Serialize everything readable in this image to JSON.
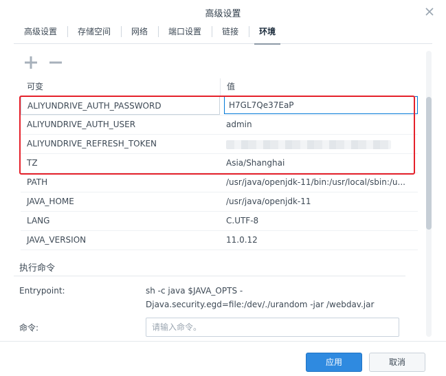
{
  "dialog": {
    "title": "高级设置",
    "close_icon": "close-icon"
  },
  "tabs": [
    {
      "label": "高级设置",
      "active": false
    },
    {
      "label": "存储空间",
      "active": false
    },
    {
      "label": "网络",
      "active": false
    },
    {
      "label": "端口设置",
      "active": false
    },
    {
      "label": "链接",
      "active": false
    },
    {
      "label": "环境",
      "active": true
    }
  ],
  "toolbar": {
    "add_icon": "plus-icon",
    "remove_icon": "minus-icon"
  },
  "env_table": {
    "headers": {
      "variable": "可变",
      "value": "值"
    },
    "rows": [
      {
        "name": "ALIYUNDRIVE_AUTH_PASSWORD",
        "value": "H7GL7Qe37EaP"
      },
      {
        "name": "ALIYUNDRIVE_AUTH_USER",
        "value": "admin"
      },
      {
        "name": "ALIYUNDRIVE_REFRESH_TOKEN",
        "value": ""
      },
      {
        "name": "TZ",
        "value": "Asia/Shanghai"
      },
      {
        "name": "PATH",
        "value": "/usr/java/openjdk-11/bin:/usr/local/sbin:/u..."
      },
      {
        "name": "JAVA_HOME",
        "value": "/usr/java/openjdk-11"
      },
      {
        "name": "LANG",
        "value": "C.UTF-8"
      },
      {
        "name": "JAVA_VERSION",
        "value": "11.0.12"
      }
    ]
  },
  "exec_section": {
    "title": "执行命令",
    "entrypoint_label": "Entrypoint:",
    "entrypoint_value_line1": "sh -c java $JAVA_OPTS -",
    "entrypoint_value_line2": "Djava.security.egd=file:/dev/./urandom -jar /webdav.jar",
    "command_label": "命令:",
    "command_placeholder": "请输入命令。"
  },
  "footer": {
    "apply_label": "应用",
    "cancel_label": "取消"
  },
  "colors": {
    "accent": "#2f8ae0",
    "highlight_border": "#e5202a",
    "text": "#3d4955"
  }
}
